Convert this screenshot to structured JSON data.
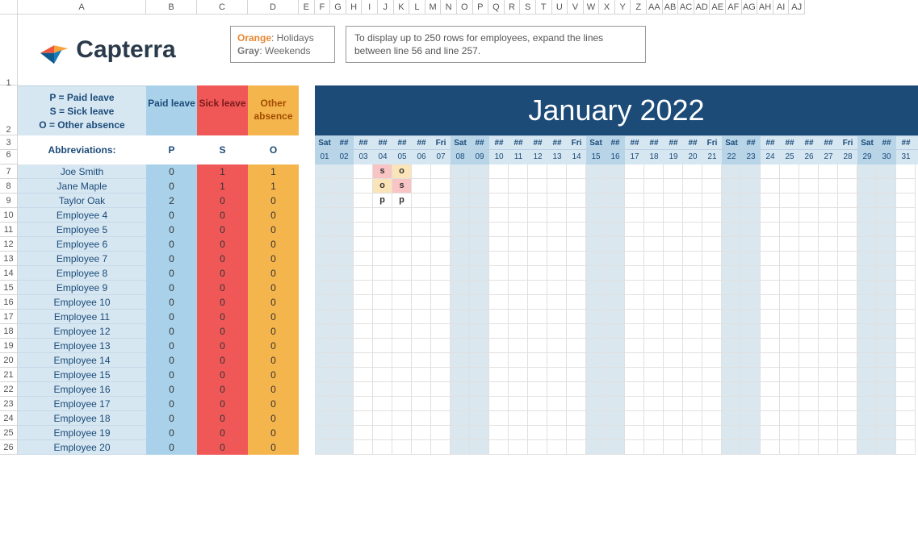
{
  "logo_text": "Capterra",
  "legend": {
    "orange_label": "Orange",
    "orange_text": ": Holidays",
    "gray_label": "Gray",
    "gray_text": ": Weekends"
  },
  "help_text": "To display up to 250 rows for employees, expand the lines between line 56 and line 257.",
  "abbrev_def": {
    "line1": "P = Paid leave",
    "line2": "S = Sick leave",
    "line3": "O = Other absence"
  },
  "headers": {
    "paid": "Paid leave",
    "sick": "Sick leave",
    "other": "Other absence"
  },
  "banner_title": "January 2022",
  "abbrev_title": "Abbreviations:",
  "abbr": {
    "p": "P",
    "s": "S",
    "o": "O"
  },
  "columns": [
    "A",
    "B",
    "C",
    "D",
    "E",
    "F",
    "G",
    "H",
    "I",
    "J",
    "K",
    "L",
    "M",
    "N",
    "O",
    "P",
    "Q",
    "R",
    "S",
    "T",
    "U",
    "V",
    "W",
    "X",
    "Y",
    "Z",
    "AA",
    "AB",
    "AC",
    "AD",
    "AE",
    "AF",
    "AG",
    "AH",
    "AI",
    "AJ"
  ],
  "row_numbers_visible": [
    "1",
    "2",
    "3",
    "6",
    "7",
    "8",
    "9",
    "10",
    "11",
    "12",
    "13",
    "14",
    "15",
    "16",
    "17",
    "18",
    "19",
    "20",
    "21",
    "22",
    "23",
    "24",
    "25",
    "26"
  ],
  "dow": [
    "Sat",
    "##",
    "##",
    "##",
    "##",
    "##",
    "Fri",
    "Sat",
    "##",
    "##",
    "##",
    "##",
    "##",
    "Fri",
    "Sat",
    "##",
    "##",
    "##",
    "##",
    "##",
    "Fri",
    "Sat",
    "##",
    "##",
    "##",
    "##",
    "##",
    "Fri",
    "Sat",
    "##",
    "##"
  ],
  "days": [
    "01",
    "02",
    "03",
    "04",
    "05",
    "06",
    "07",
    "08",
    "09",
    "10",
    "11",
    "12",
    "13",
    "14",
    "15",
    "16",
    "17",
    "18",
    "19",
    "20",
    "21",
    "22",
    "23",
    "24",
    "25",
    "26",
    "27",
    "28",
    "29",
    "30",
    "31"
  ],
  "weekend_indices": [
    0,
    1,
    7,
    8,
    14,
    15,
    21,
    22,
    28,
    29
  ],
  "employees": [
    {
      "name": "Joe Smith",
      "paid": 0,
      "sick": 1,
      "other": 1,
      "cells": {
        "4": "s",
        "5": "o"
      }
    },
    {
      "name": "Jane Maple",
      "paid": 0,
      "sick": 1,
      "other": 1,
      "cells": {
        "4": "o",
        "5": "s"
      }
    },
    {
      "name": "Taylor Oak",
      "paid": 2,
      "sick": 0,
      "other": 0,
      "cells": {
        "4": "p",
        "5": "p"
      }
    },
    {
      "name": "Employee 4",
      "paid": 0,
      "sick": 0,
      "other": 0,
      "cells": {}
    },
    {
      "name": "Employee 5",
      "paid": 0,
      "sick": 0,
      "other": 0,
      "cells": {}
    },
    {
      "name": "Employee 6",
      "paid": 0,
      "sick": 0,
      "other": 0,
      "cells": {}
    },
    {
      "name": "Employee 7",
      "paid": 0,
      "sick": 0,
      "other": 0,
      "cells": {}
    },
    {
      "name": "Employee 8",
      "paid": 0,
      "sick": 0,
      "other": 0,
      "cells": {}
    },
    {
      "name": "Employee 9",
      "paid": 0,
      "sick": 0,
      "other": 0,
      "cells": {}
    },
    {
      "name": "Employee 10",
      "paid": 0,
      "sick": 0,
      "other": 0,
      "cells": {}
    },
    {
      "name": "Employee 11",
      "paid": 0,
      "sick": 0,
      "other": 0,
      "cells": {}
    },
    {
      "name": "Employee 12",
      "paid": 0,
      "sick": 0,
      "other": 0,
      "cells": {}
    },
    {
      "name": "Employee 13",
      "paid": 0,
      "sick": 0,
      "other": 0,
      "cells": {}
    },
    {
      "name": "Employee 14",
      "paid": 0,
      "sick": 0,
      "other": 0,
      "cells": {}
    },
    {
      "name": "Employee 15",
      "paid": 0,
      "sick": 0,
      "other": 0,
      "cells": {}
    },
    {
      "name": "Employee 16",
      "paid": 0,
      "sick": 0,
      "other": 0,
      "cells": {}
    },
    {
      "name": "Employee 17",
      "paid": 0,
      "sick": 0,
      "other": 0,
      "cells": {}
    },
    {
      "name": "Employee 18",
      "paid": 0,
      "sick": 0,
      "other": 0,
      "cells": {}
    },
    {
      "name": "Employee 19",
      "paid": 0,
      "sick": 0,
      "other": 0,
      "cells": {}
    },
    {
      "name": "Employee 20",
      "paid": 0,
      "sick": 0,
      "other": 0,
      "cells": {}
    }
  ]
}
